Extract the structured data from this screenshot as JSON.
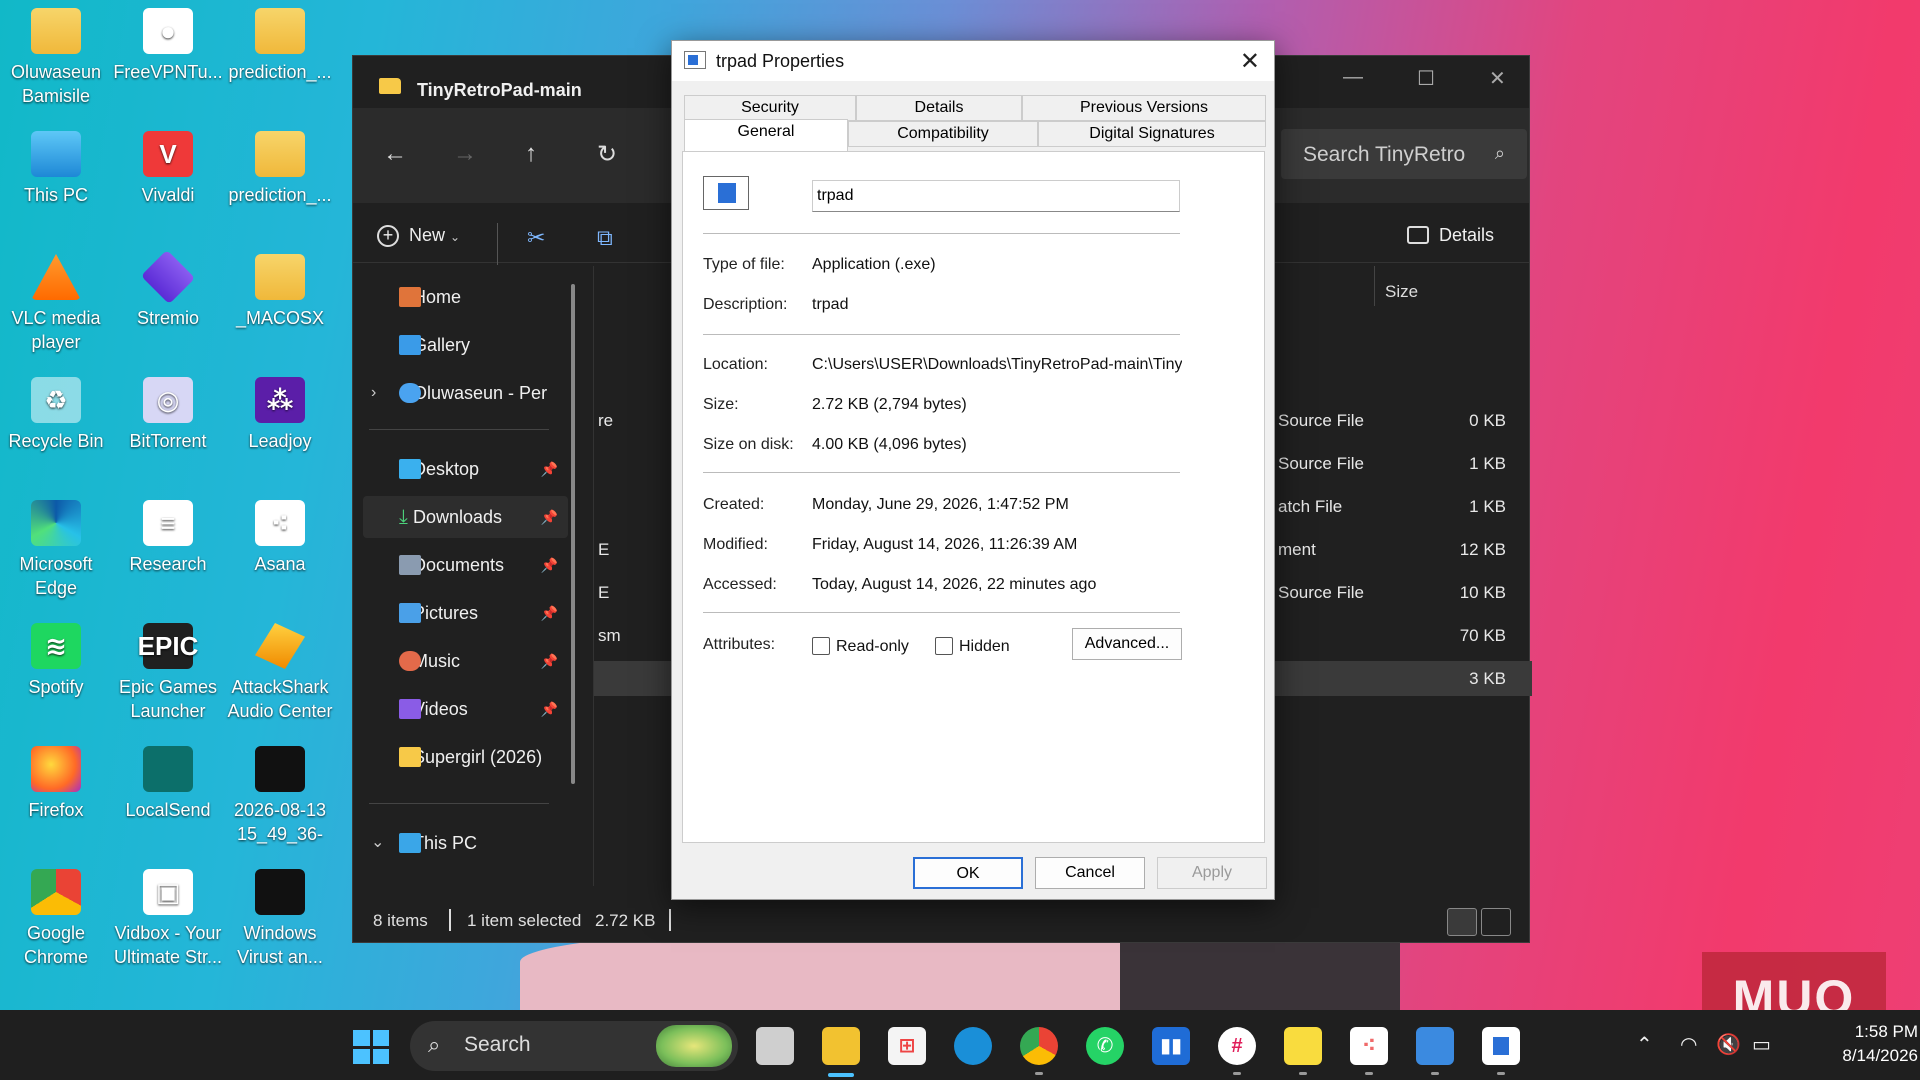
{
  "desktop": {
    "icons": [
      {
        "label": "Oluwaseun Bamisile",
        "icon": "folder-icon"
      },
      {
        "label": "This PC",
        "icon": "computer-icon"
      },
      {
        "label": "VLC media player",
        "icon": "vlc-icon"
      },
      {
        "label": "Recycle Bin",
        "icon": "recycle-bin-icon"
      },
      {
        "label": "Microsoft Edge",
        "icon": "edge-icon"
      },
      {
        "label": "Spotify",
        "icon": "spotify-icon"
      },
      {
        "label": "Firefox",
        "icon": "firefox-icon"
      },
      {
        "label": "Google Chrome",
        "icon": "chrome-icon"
      },
      {
        "label": "FreeVPNTu...",
        "icon": "vpn-icon"
      },
      {
        "label": "Vivaldi",
        "icon": "vivaldi-icon"
      },
      {
        "label": "Stremio",
        "icon": "stremio-icon"
      },
      {
        "label": "BitTorrent",
        "icon": "bittorrent-icon"
      },
      {
        "label": "Research",
        "icon": "document-icon"
      },
      {
        "label": "Epic Games Launcher",
        "icon": "epic-games-icon"
      },
      {
        "label": "LocalSend",
        "icon": "localsend-icon"
      },
      {
        "label": "Vidbox - Your Ultimate Str...",
        "icon": "vidbox-icon"
      },
      {
        "label": "prediction_...",
        "icon": "zip-folder-icon"
      },
      {
        "label": "prediction_...",
        "icon": "zip-folder-icon"
      },
      {
        "label": "_MACOSX",
        "icon": "folder-icon"
      },
      {
        "label": "Leadjoy",
        "icon": "leadjoy-icon"
      },
      {
        "label": "Asana",
        "icon": "asana-icon"
      },
      {
        "label": "AttackShark Audio Center",
        "icon": "attackshark-icon"
      },
      {
        "label": "2026-08-13 15_49_36-",
        "icon": "image-thumbnail-icon"
      },
      {
        "label": "Windows Virust an...",
        "icon": "image-thumbnail-icon"
      }
    ]
  },
  "explorer": {
    "title": "TinyRetroPad-main",
    "search_placeholder": "Search TinyRetro",
    "new_label": "New",
    "details_label": "Details",
    "sidebar": {
      "home": "Home",
      "gallery": "Gallery",
      "onedrive": "Oluwaseun - Per",
      "desktop": "Desktop",
      "downloads": "Downloads",
      "documents": "Documents",
      "pictures": "Pictures",
      "music": "Music",
      "videos": "Videos",
      "supergirl": "Supergirl (2026)",
      "thispc": "This PC"
    },
    "columns": {
      "size": "Size"
    },
    "rows": [
      {
        "left": "re",
        "type": "Source File",
        "size": "0 KB"
      },
      {
        "left": "",
        "type": "Source File",
        "size": "1 KB"
      },
      {
        "left": "",
        "type": "atch File",
        "size": "1 KB"
      },
      {
        "left": "E",
        "type": "ment",
        "size": "12 KB"
      },
      {
        "left": "E",
        "type": "Source File",
        "size": "10 KB"
      },
      {
        "left": "sm",
        "type": "",
        "size": "70 KB"
      },
      {
        "left": "",
        "type": "",
        "size": "3 KB"
      }
    ],
    "status": {
      "items": "8 items",
      "selected": "1 item selected",
      "size": "2.72 KB"
    }
  },
  "dialog": {
    "title": "trpad Properties",
    "tabs": {
      "security": "Security",
      "details": "Details",
      "previous": "Previous Versions",
      "general": "General",
      "compatibility": "Compatibility",
      "signatures": "Digital Signatures"
    },
    "filename": "trpad",
    "fields": {
      "type_k": "Type of file:",
      "type_v": "Application (.exe)",
      "desc_k": "Description:",
      "desc_v": "trpad",
      "loc_k": "Location:",
      "loc_v": "C:\\Users\\USER\\Downloads\\TinyRetroPad-main\\TinyR",
      "size_k": "Size:",
      "size_v": "2.72 KB (2,794 bytes)",
      "disk_k": "Size on disk:",
      "disk_v": "4.00 KB (4,096 bytes)",
      "created_k": "Created:",
      "created_v": "Monday, June 29, 2026, 1:47:52 PM",
      "modified_k": "Modified:",
      "modified_v": "Friday, August 14, 2026, 11:26:39 AM",
      "accessed_k": "Accessed:",
      "accessed_v": "Today, August 14, 2026, 22 minutes ago",
      "attr_k": "Attributes:"
    },
    "readonly": "Read-only",
    "hidden": "Hidden",
    "advanced": "Advanced...",
    "ok": "OK",
    "cancel": "Cancel",
    "apply": "Apply"
  },
  "taskbar": {
    "search": "Search",
    "time": "1:58 PM",
    "date": "8/14/2026"
  },
  "watermark": "MUO"
}
